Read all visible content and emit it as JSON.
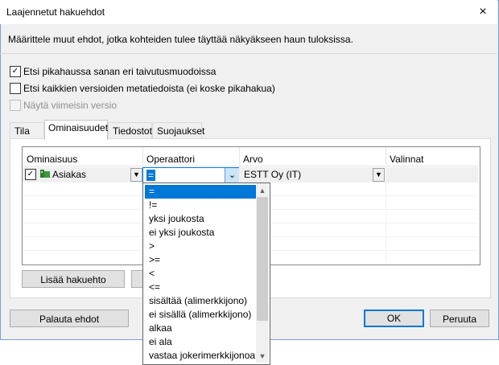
{
  "window": {
    "title": "Laajennetut hakuehdot",
    "description": "Määrittele muut ehdot, jotka kohteiden tulee täyttää näkyäkseen haun tuloksissa."
  },
  "options": [
    {
      "label": "Etsi pikahaussa sanan eri taivutusmuodoissa",
      "checked": true,
      "enabled": true
    },
    {
      "label": "Etsi kaikkien versioiden metatiedoista (ei koske pikahakua)",
      "checked": false,
      "enabled": true
    },
    {
      "label": "Näytä viimeisin versio",
      "checked": false,
      "enabled": false
    }
  ],
  "tabs": [
    "Tila",
    "Ominaisuudet",
    "Tiedostot",
    "Suojaukset"
  ],
  "active_tab": "Ominaisuudet",
  "grid": {
    "columns": [
      "Ominaisuus",
      "Operaattori",
      "Arvo",
      "Valinnat"
    ],
    "row": {
      "property": "Asiakas",
      "operator": "=",
      "value": "ESTT Oy (IT)",
      "checked": true
    }
  },
  "buttons": {
    "add_condition": "Lisää hakuehto",
    "reset": "Palauta ehdot",
    "ok": "OK",
    "cancel": "Peruuta"
  },
  "operator_dropdown": {
    "items": [
      "=",
      "!=",
      "yksi joukosta",
      "ei yksi joukosta",
      ">",
      ">=",
      "<",
      "<=",
      "sisältää (alimerkkijono)",
      "ei sisällä (alimerkkijono)",
      "alkaa",
      "ei ala",
      "vastaa jokerimerkkijonoa"
    ],
    "selected": "="
  },
  "icons": {
    "close": "×",
    "check": "✓",
    "arrow_down": "▼",
    "arrow_up": "▲",
    "chevron_down": "⌄"
  },
  "colors": {
    "accent": "#0078d7",
    "window_border": "#7a9fd4",
    "property_icon": "#3c9a3c"
  }
}
